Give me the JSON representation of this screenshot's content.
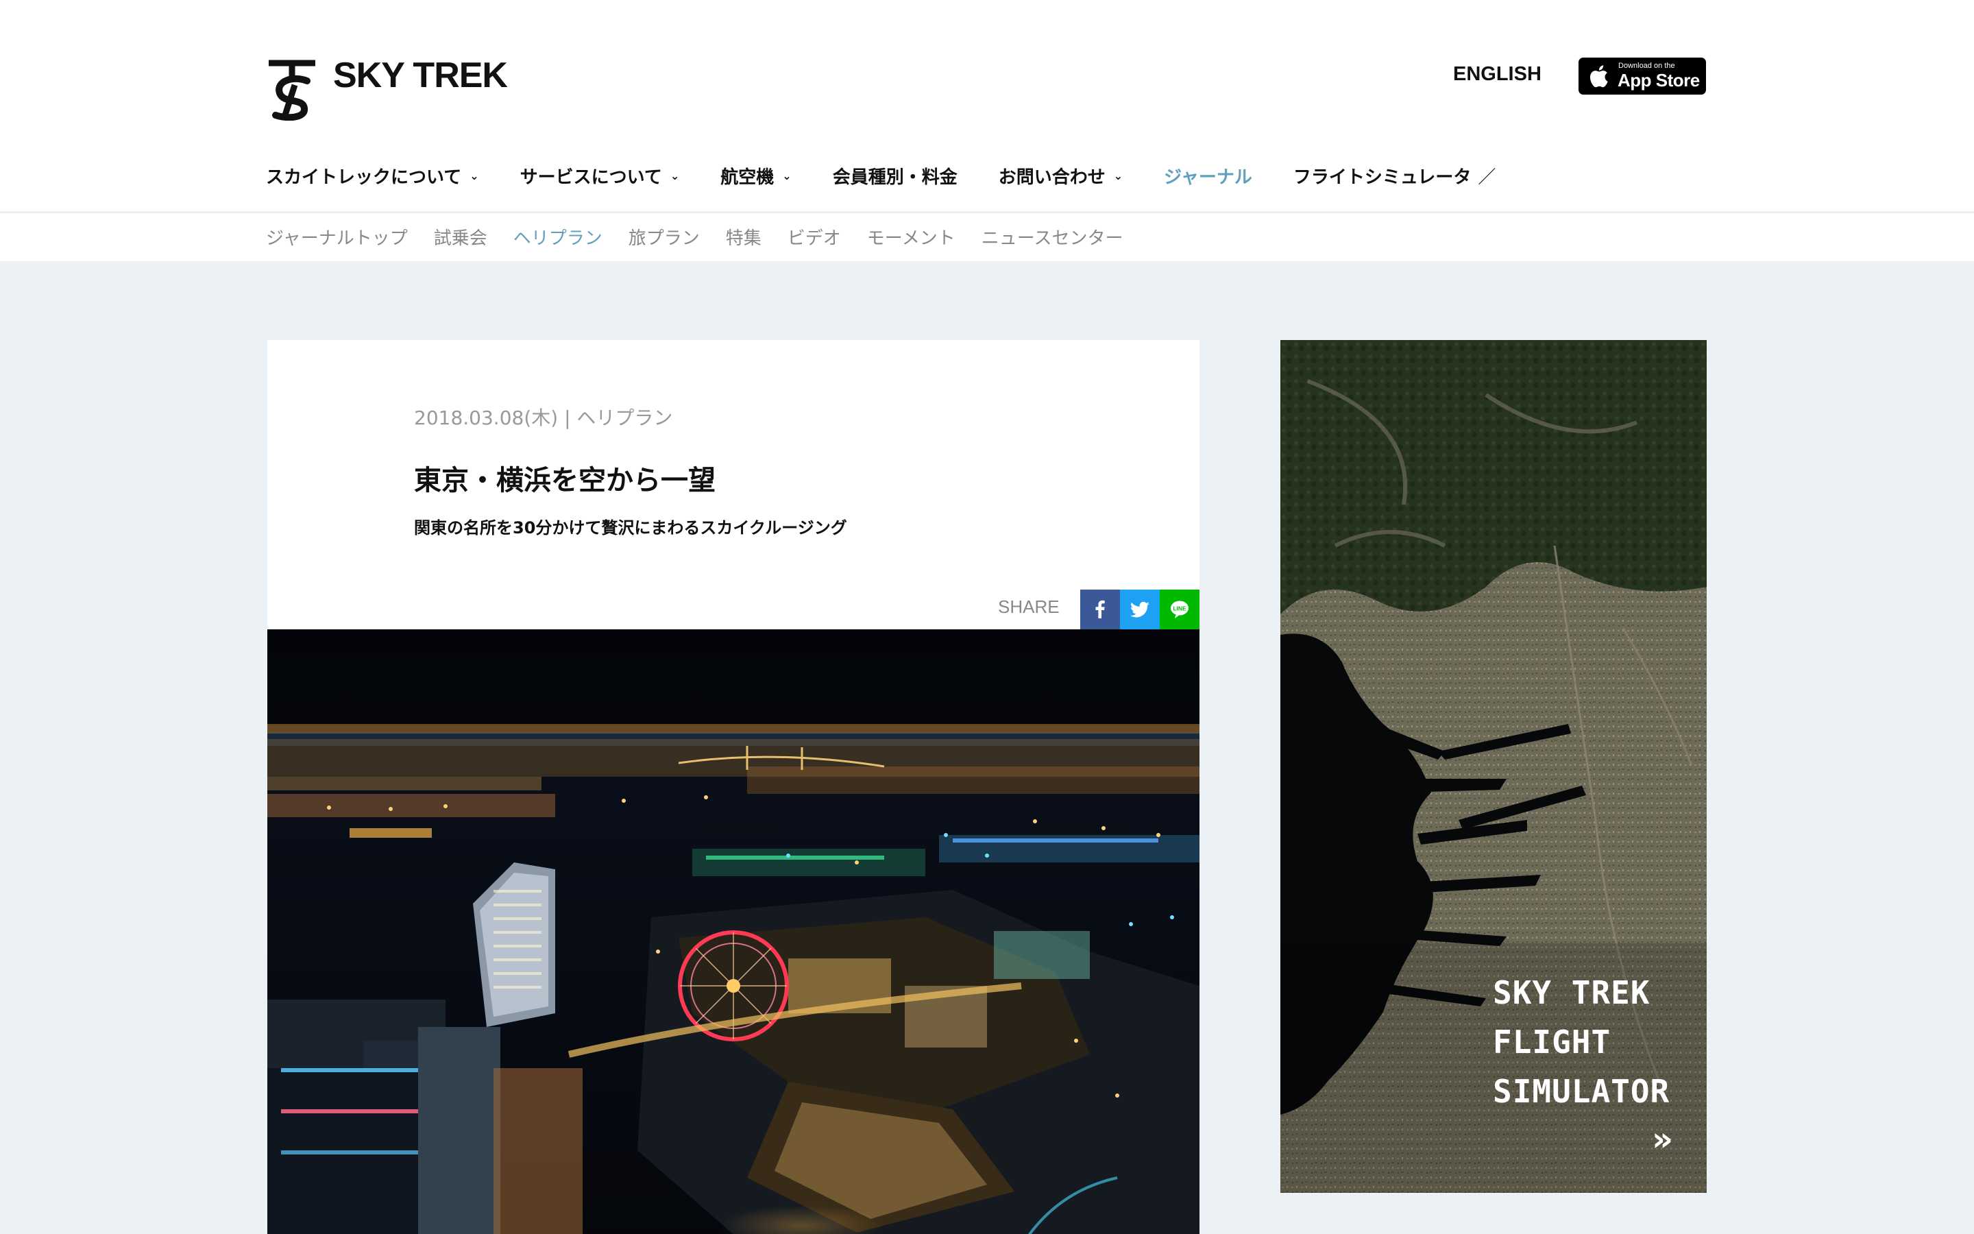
{
  "header": {
    "logo_text": "SKY TREK",
    "lang_link": "ENGLISH",
    "appstore": {
      "small": "Download on the",
      "big": "App Store"
    }
  },
  "main_nav": [
    {
      "label": "スカイトレックについて",
      "has_dropdown": true
    },
    {
      "label": "サービスについて",
      "has_dropdown": true
    },
    {
      "label": "航空機",
      "has_dropdown": true
    },
    {
      "label": "会員種別・料金",
      "has_dropdown": false
    },
    {
      "label": "お問い合わせ",
      "has_dropdown": true
    },
    {
      "label": "ジャーナル",
      "has_dropdown": false,
      "active": true
    },
    {
      "label": "フライトシミュレータ",
      "external": true
    }
  ],
  "sub_nav": [
    {
      "label": "ジャーナルトップ"
    },
    {
      "label": "試乗会"
    },
    {
      "label": "ヘリプラン",
      "active": true
    },
    {
      "label": "旅プラン"
    },
    {
      "label": "特集"
    },
    {
      "label": "ビデオ"
    },
    {
      "label": "モーメント"
    },
    {
      "label": "ニュースセンター"
    }
  ],
  "article": {
    "date": "2018.03.08(木)",
    "separator": "|",
    "category": "ヘリプラン",
    "title": "東京・横浜を空から一望",
    "subtitle": "関東の名所を30分かけて贅沢にまわるスカイクルージング",
    "share_label": "SHARE",
    "share_buttons": [
      "facebook-icon",
      "twitter-icon",
      "line-icon"
    ]
  },
  "banner": {
    "lines": [
      "SKY TREK",
      "FLIGHT",
      "SIMULATOR"
    ],
    "arrow": "»"
  },
  "colors": {
    "accent": "#5fa0bd",
    "page_bg": "#ebf1f4",
    "facebook": "#3b5998",
    "twitter": "#1da1f2",
    "line": "#00b900"
  }
}
